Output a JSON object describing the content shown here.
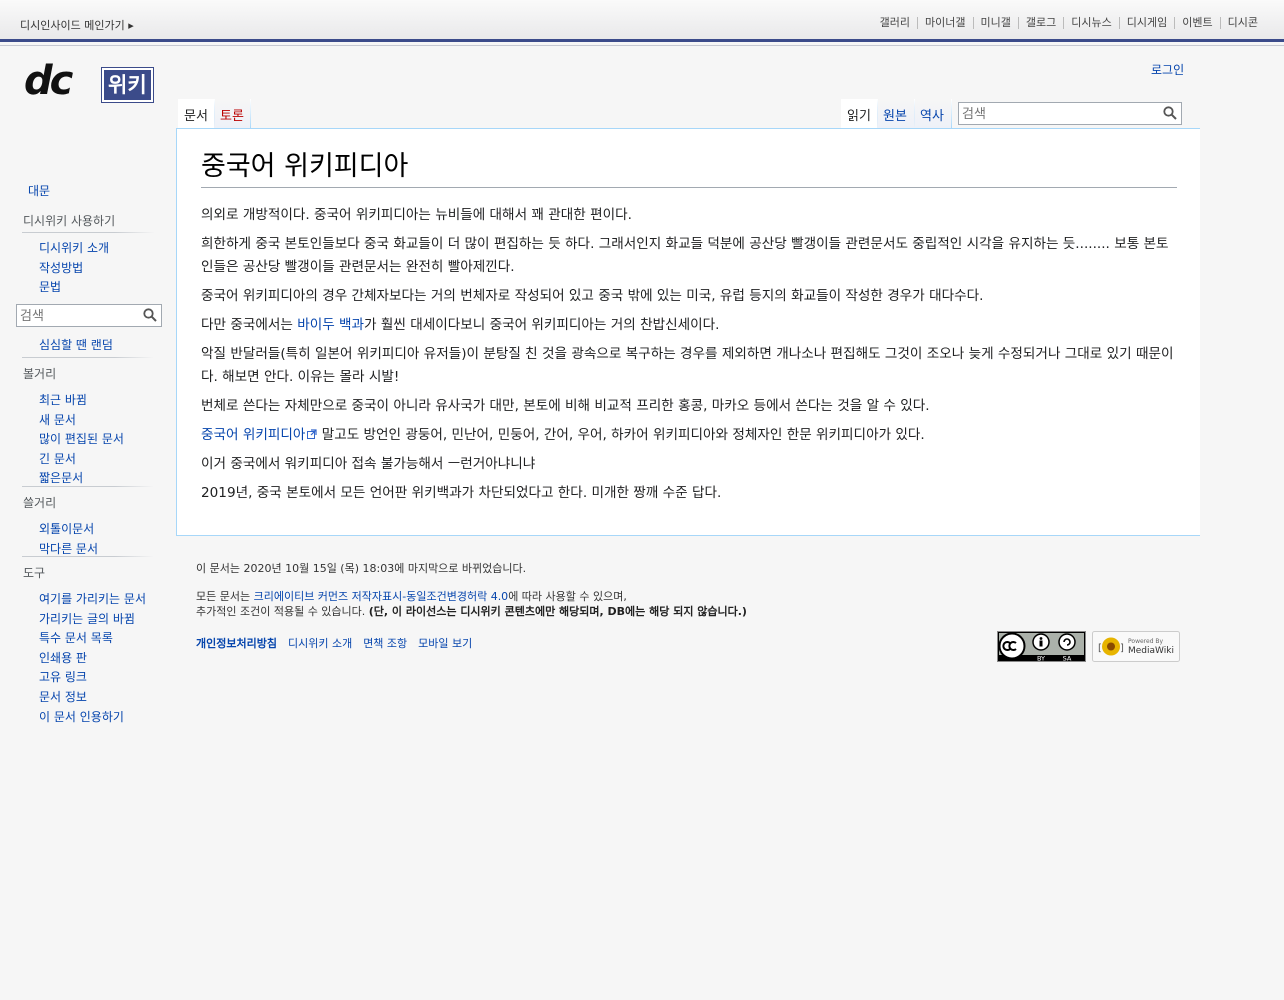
{
  "topbar": {
    "home": "디시인사이드 메인가기 ▸",
    "links": [
      "갤러리",
      "마이너갤",
      "미니갤",
      "갤로그",
      "디시뉴스",
      "디시게임",
      "이벤트",
      "디시콘"
    ]
  },
  "logo": {
    "brand": "dc",
    "suffix": "위키"
  },
  "personal": {
    "login": "로그인"
  },
  "tabs": {
    "doc": "문서",
    "talk": "토론",
    "read": "읽기",
    "source": "원본",
    "history": "역사"
  },
  "search": {
    "placeholder": "검색"
  },
  "sidebar": {
    "main": "대문",
    "usage": {
      "title": "디시위키 사용하기",
      "items": [
        "디시위키 소개",
        "작성방법",
        "문법"
      ]
    },
    "search_placeholder": "검색",
    "random": "심심할 땐 랜덤",
    "browse": {
      "title": "볼거리",
      "items": [
        "최근 바뀜",
        "새 문서",
        "많이 편집된 문서",
        "긴 문서",
        "짧은문서"
      ]
    },
    "junk": {
      "title": "쓸거리",
      "items": [
        "외톨이문서",
        "막다른 문서"
      ]
    },
    "tools": {
      "title": "도구",
      "items": [
        "여기를 가리키는 문서",
        "가리키는 글의 바뀜",
        "특수 문서 목록",
        "인쇄용 판",
        "고유 링크",
        "문서 정보",
        "이 문서 인용하기"
      ]
    }
  },
  "article": {
    "title": "중국어 위키피디아",
    "p1": "의외로 개방적이다. 중국어 위키피디아는 뉴비들에 대해서 꽤 관대한 편이다.",
    "p2": "희한하게 중국 본토인들보다 중국 화교들이 더 많이 편집하는 듯 하다. 그래서인지 화교들 덕분에 공산당 빨갱이들 관련문서도 중립적인 시각을 유지하는 듯........ 보통 본토인들은 공산당 빨갱이들 관련문서는 완전히 빨아제낀다.",
    "p3": "중국어 위키피디아의 경우 간체자보다는 거의 번체자로 작성되어 있고 중국 밖에 있는 미국, 유럽 등지의 화교들이 작성한 경우가 대다수다.",
    "p4_before": "다만 중국에서는 ",
    "p4_link": "바이두 백과",
    "p4_after": "가 훨씬 대세이다보니 중국어 위키피디아는 거의 찬밥신세이다.",
    "p5": "악질 반달러들(특히 일본어 위키피디아 유저들)이 분탕질 친 것을 광속으로 복구하는 경우를 제외하면 개나소나 편집해도 그것이 조오나 늦게 수정되거나 그대로 있기 때문이다. 해보면 안다. 이유는 몰라 시발!",
    "p6": "번체로 쓴다는 자체만으로 중국이 아니라 유사국가 대만, 본토에 비해 비교적 프리한 홍콩, 마카오 등에서 쓴다는 것을 알 수 있다.",
    "p7_link": "중국어 위키피디아",
    "p7_after": " 말고도 방언인 광둥어, 민난어, 민둥어, 간어, 우어, 하카어 위키피디아와 정체자인 한문 위키피디아가 있다.",
    "p8": "이거 중국에서 워키피디아 접속 불가능해서 ㅡ런거아냐니냐",
    "p9": "2019년, 중국 본토에서 모든 언어판 위키백과가 차단되었다고 한다. 미개한 짱깨 수준 답다."
  },
  "footer": {
    "lastmod": "이 문서는 2020년 10월 15일 (목) 18:03에 마지막으로 바뀌었습니다.",
    "license_before": "모든 문서는 ",
    "license_link": "크리에이티브 커먼즈 저작자표시-동일조건변경허락 4.0",
    "license_after": "에 따라 사용할 수 있으며,",
    "license_line2": "추가적인 조건이 적용될 수 있습니다. ",
    "license_bold": "(단, 이 라이선스는 디시위키 콘텐츠에만 해당되며, DB에는 해당 되지 않습니다.)",
    "links": [
      "개인정보처리방침",
      "디시위키 소개",
      "면책 조항",
      "모바일 보기"
    ],
    "cc_badge": {
      "tags": [
        "BY",
        "SA"
      ]
    },
    "mw_badge": {
      "top": "Powered By",
      "bottom": "MediaWiki"
    }
  },
  "colors": {
    "accent": "#3b4b8a",
    "link": "#0645ad",
    "new_link": "#ba0000",
    "border": "#a7d7f9"
  }
}
